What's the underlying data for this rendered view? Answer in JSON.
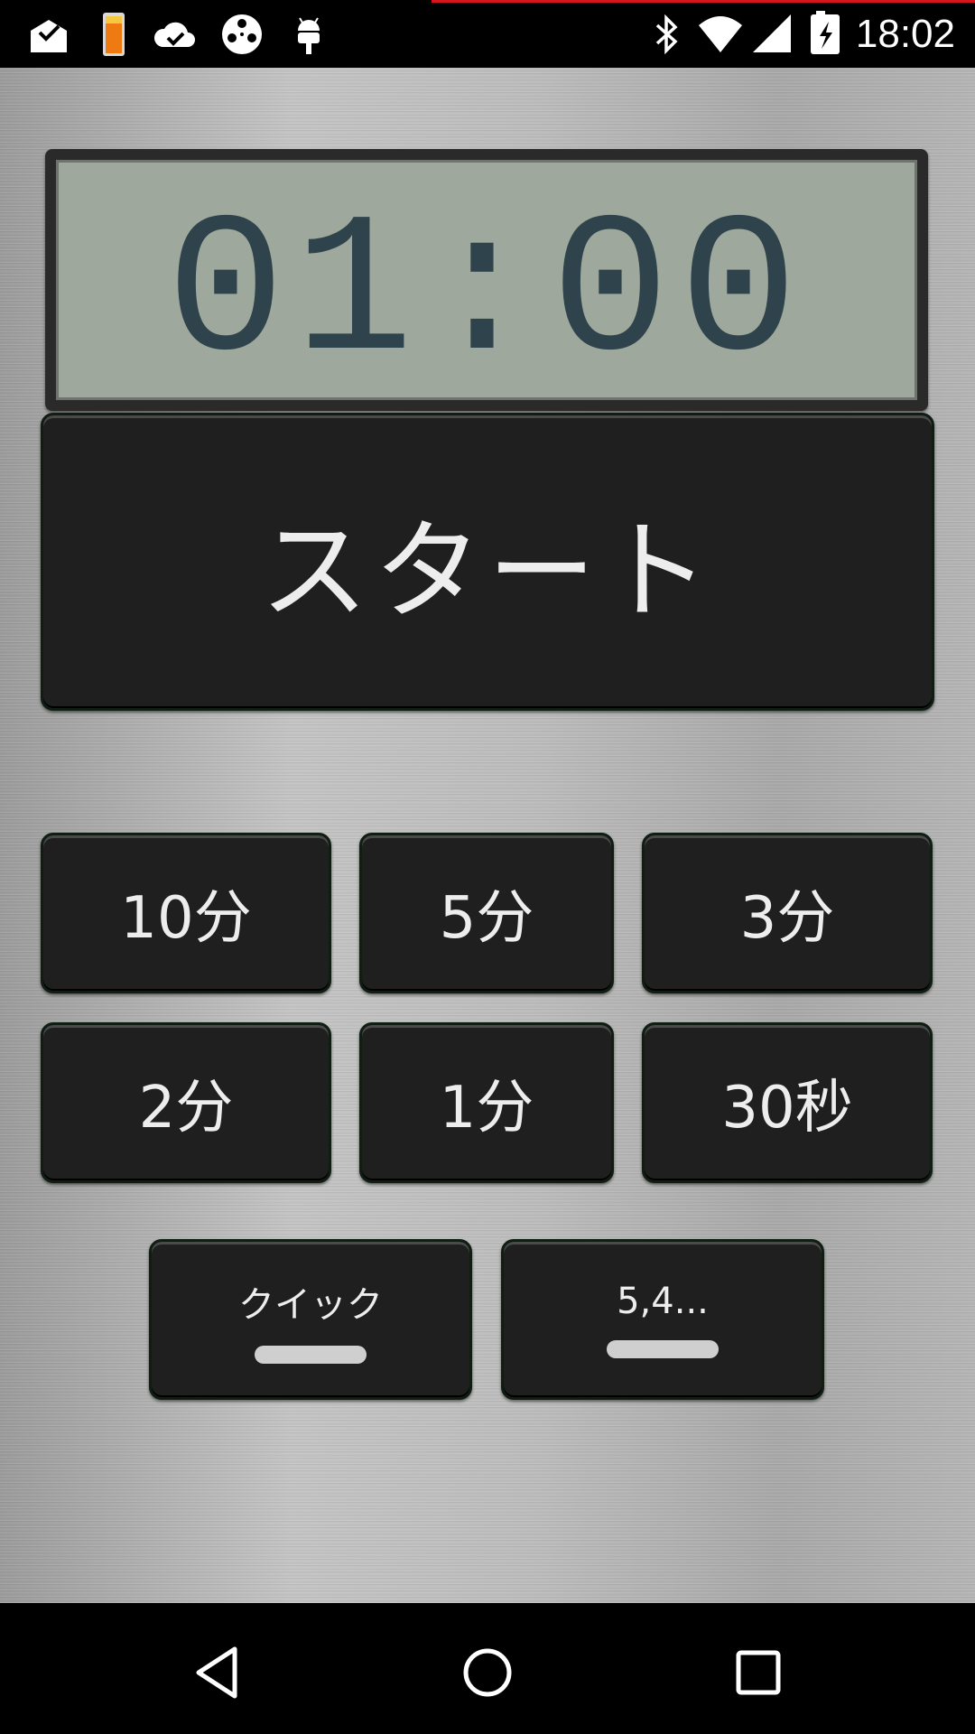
{
  "status_bar": {
    "time": "18:02",
    "left_icons": [
      "inbox-check-icon",
      "battery-charging-icon",
      "cloud-check-icon",
      "film-reel-icon",
      "android-icon"
    ],
    "right_icons": [
      "bluetooth-icon",
      "wifi-icon",
      "signal-icon",
      "battery-icon"
    ]
  },
  "timer": {
    "display": "01:00"
  },
  "start_button": {
    "label": "スタート"
  },
  "presets": {
    "row1": [
      "10分",
      "5分",
      "3分"
    ],
    "row2": [
      "2分",
      "1分",
      "30秒"
    ]
  },
  "bottom_buttons": {
    "quick_label": "クイック",
    "custom_label": "5,4..."
  },
  "nav_bar": {
    "icons": [
      "back-icon",
      "home-icon",
      "recents-icon"
    ]
  },
  "colors": {
    "lcd_background": "#9ea89c",
    "lcd_segment": "#2e434b",
    "button_bg": "#1f1f1f",
    "button_text": "#ededed"
  }
}
